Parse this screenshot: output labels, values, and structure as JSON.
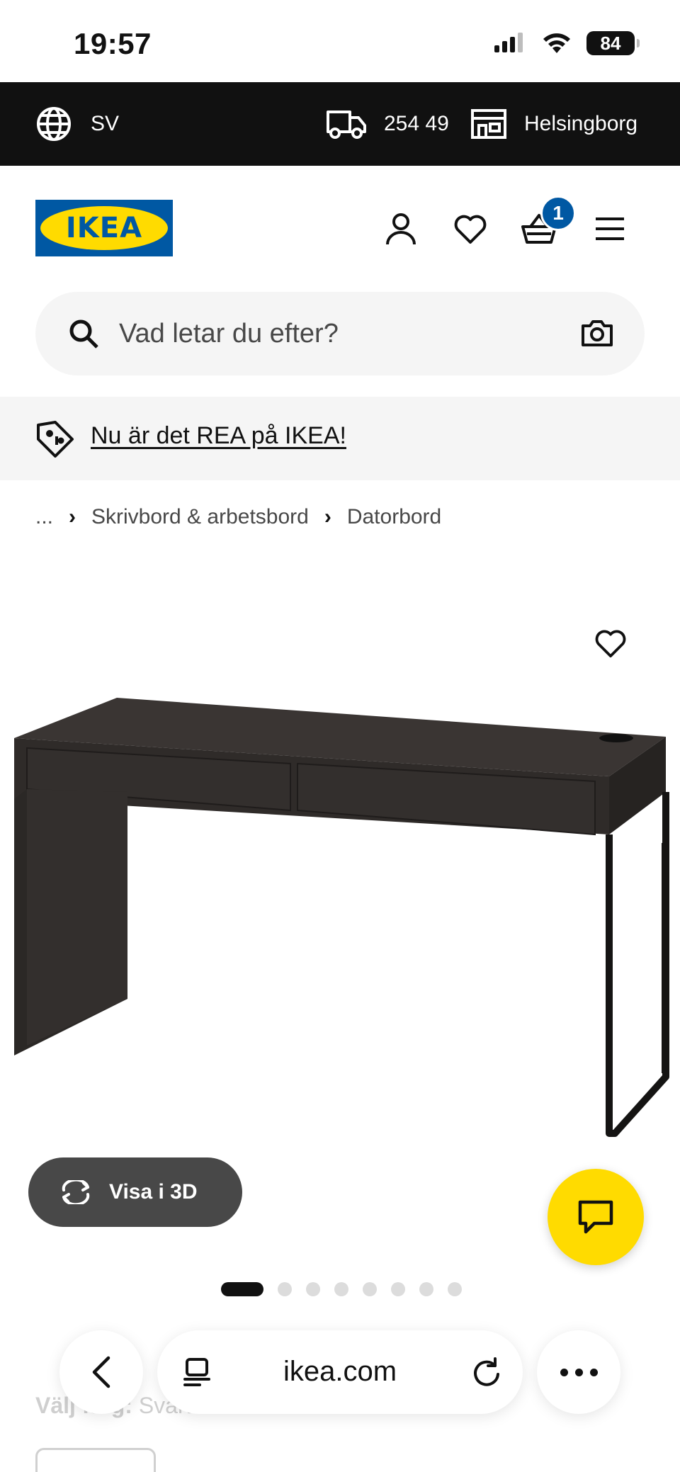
{
  "status_bar": {
    "time": "19:57",
    "battery": "84"
  },
  "top_bar": {
    "language": "SV",
    "postal_code": "254 49",
    "store": "Helsingborg"
  },
  "header": {
    "logo_text": "IKEA",
    "cart_count": "1"
  },
  "search": {
    "placeholder": "Vad letar du efter?"
  },
  "promo": {
    "link_text": "Nu är det REA på IKEA!"
  },
  "breadcrumb": {
    "ellipsis": "...",
    "items": [
      "Skrivbord & arbetsbord",
      "Datorbord"
    ]
  },
  "product": {
    "view_3d_label": "Visa i 3D",
    "image_count": 8,
    "active_image": 1
  },
  "color_select": {
    "label": "Välj färg:",
    "value": "Svartbrun"
  },
  "browser": {
    "url": "ikea.com"
  },
  "colors": {
    "ikea_blue": "#0058a3",
    "ikea_yellow": "#ffdb00",
    "dark": "#111111",
    "gray_button": "#484848"
  }
}
